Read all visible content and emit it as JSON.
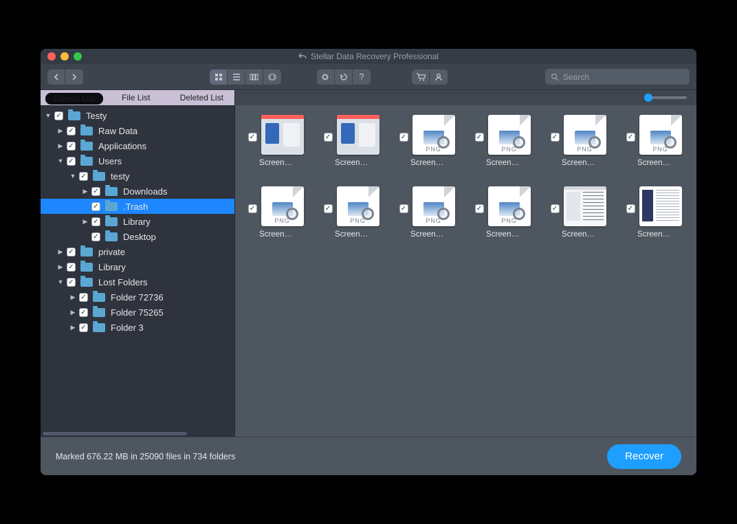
{
  "window": {
    "title": "Stellar Data Recovery Professional"
  },
  "search": {
    "placeholder": "Search"
  },
  "tabs": {
    "classic": "Classic List",
    "file": "File List",
    "deleted": "Deleted List"
  },
  "tree": [
    {
      "depth": 0,
      "exp": "open",
      "name": "Testy"
    },
    {
      "depth": 1,
      "exp": "closed",
      "name": "Raw Data"
    },
    {
      "depth": 1,
      "exp": "closed",
      "name": "Applications"
    },
    {
      "depth": 1,
      "exp": "open",
      "name": "Users"
    },
    {
      "depth": 2,
      "exp": "open",
      "name": "testy"
    },
    {
      "depth": 3,
      "exp": "closed",
      "name": "Downloads"
    },
    {
      "depth": 3,
      "exp": "none",
      "name": ".Trash",
      "selected": true
    },
    {
      "depth": 3,
      "exp": "closed",
      "name": "Library"
    },
    {
      "depth": 3,
      "exp": "none",
      "name": "Desktop"
    },
    {
      "depth": 1,
      "exp": "closed",
      "name": "private"
    },
    {
      "depth": 1,
      "exp": "closed",
      "name": "Library"
    },
    {
      "depth": 1,
      "exp": "open",
      "name": "Lost Folders"
    },
    {
      "depth": 2,
      "exp": "closed",
      "name": "Folder 72736"
    },
    {
      "depth": 2,
      "exp": "closed",
      "name": "Folder 75265"
    },
    {
      "depth": 2,
      "exp": "closed",
      "name": "Folder 3"
    }
  ],
  "files": [
    {
      "name": "Screen…",
      "kind": "shot"
    },
    {
      "name": "Screen…",
      "kind": "shot"
    },
    {
      "name": "Screen…",
      "kind": "png"
    },
    {
      "name": "Screen…",
      "kind": "png"
    },
    {
      "name": "Screen…",
      "kind": "png"
    },
    {
      "name": "Screen…",
      "kind": "png"
    },
    {
      "name": "Screen…",
      "kind": "png"
    },
    {
      "name": "Screen…",
      "kind": "png"
    },
    {
      "name": "Screen…",
      "kind": "png"
    },
    {
      "name": "Screen…",
      "kind": "png"
    },
    {
      "name": "Screen…",
      "kind": "shot2"
    },
    {
      "name": "Screen…",
      "kind": "shot3"
    }
  ],
  "png_label": "PNG",
  "footer": {
    "status": "Marked 676.22 MB in 25090 files in 734 folders",
    "recover": "Recover"
  }
}
